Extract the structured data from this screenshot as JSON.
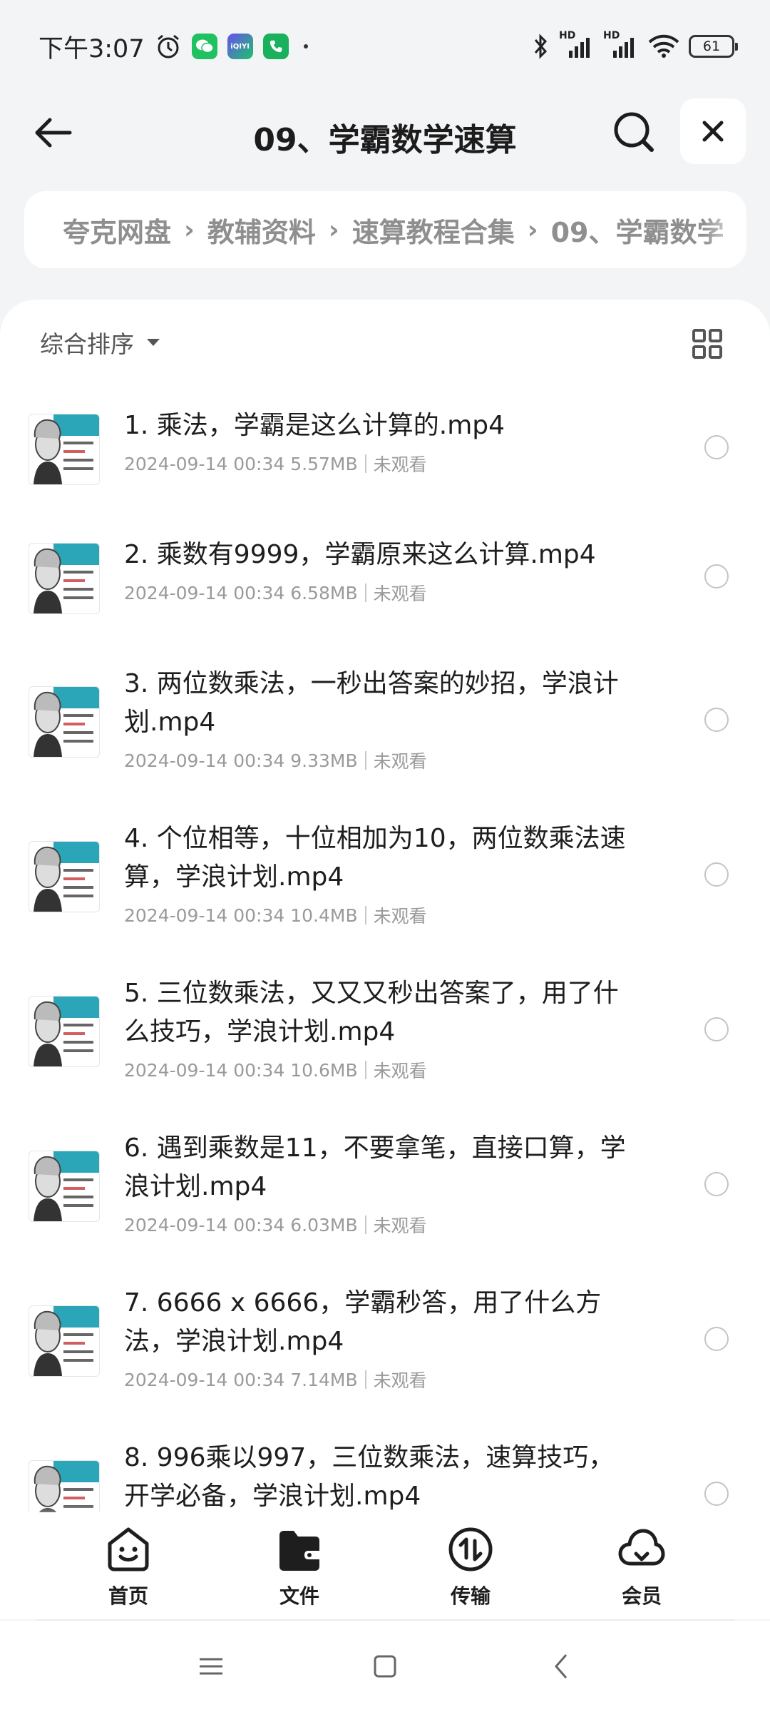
{
  "status_bar": {
    "time": "下午3:07",
    "hd1": "HD",
    "hd2": "HD",
    "battery": "61",
    "iqiyi_badge": "iQIYI"
  },
  "header": {
    "title": "09、学霸数学速算"
  },
  "breadcrumb": {
    "items": [
      "夸克网盘",
      "教辅资料",
      "速算教程合集",
      "09、学霸数学"
    ]
  },
  "toolbar": {
    "sort_label": "综合排序"
  },
  "files": [
    {
      "name": "1. 乘法，学霸是这么计算的.mp4",
      "date": "2024-09-14 00:34",
      "size": "5.57MB",
      "status": "未观看"
    },
    {
      "name": "2. 乘数有9999，学霸原来这么计算.mp4",
      "date": "2024-09-14 00:34",
      "size": "6.58MB",
      "status": "未观看"
    },
    {
      "name": "3. 两位数乘法，一秒出答案的妙招，学浪计划.mp4",
      "date": "2024-09-14 00:34",
      "size": "9.33MB",
      "status": "未观看"
    },
    {
      "name": "4. 个位相等，十位相加为10，两位数乘法速算，学浪计划.mp4",
      "date": "2024-09-14 00:34",
      "size": "10.4MB",
      "status": "未观看"
    },
    {
      "name": "5. 三位数乘法，又又又秒出答案了，用了什么技巧，学浪计划.mp4",
      "date": "2024-09-14 00:34",
      "size": "10.6MB",
      "status": "未观看"
    },
    {
      "name": "6. 遇到乘数是11，不要拿笔，直接口算，学浪计划.mp4",
      "date": "2024-09-14 00:34",
      "size": "6.03MB",
      "status": "未观看"
    },
    {
      "name": "7. 6666 x 6666，学霸秒答，用了什么方法，学浪计划.mp4",
      "date": "2024-09-14 00:34",
      "size": "7.14MB",
      "status": "未观看"
    },
    {
      "name": "8. 996乘以997，三位数乘法，速算技巧，开学必备，学浪计划.mp4",
      "date": "",
      "size": "",
      "status": ""
    }
  ],
  "bottom_nav": [
    {
      "label": "首页",
      "icon": "home-smile-icon"
    },
    {
      "label": "文件",
      "icon": "folder-icon"
    },
    {
      "label": "传输",
      "icon": "transfer-icon"
    },
    {
      "label": "会员",
      "icon": "cloud-icon"
    }
  ]
}
